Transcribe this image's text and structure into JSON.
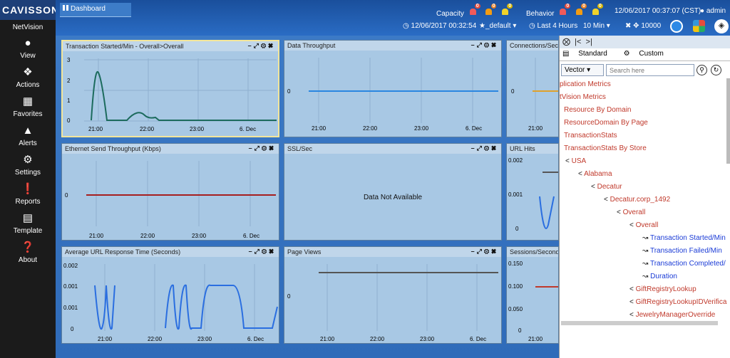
{
  "app": {
    "logo": "CAVISSON",
    "product": "NetVision",
    "dashboard_tab": "Dashboard"
  },
  "topbar": {
    "capacity_label": "Capacity",
    "capacity_badges": [
      "0",
      "0",
      "0"
    ],
    "behavior_label": "Behavior",
    "behavior_badges": [
      "0",
      "0",
      "0"
    ],
    "datetime": "12/06/2017 00:37:07 (CST)",
    "user": "admin",
    "clock_time": "12/06/2017 00:32:54",
    "favorite": "_default",
    "duration": "Last 4 Hours",
    "interval": "10 Min",
    "count": "10000"
  },
  "sidebar": {
    "items": [
      {
        "label": "View",
        "icon": "user-icon"
      },
      {
        "label": "Actions",
        "icon": "puzzle-icon"
      },
      {
        "label": "Favorites",
        "icon": "grid-icon"
      },
      {
        "label": "Alerts",
        "icon": "bell-icon"
      },
      {
        "label": "Settings",
        "icon": "gear-icon"
      },
      {
        "label": "Reports",
        "icon": "exclamation-icon"
      },
      {
        "label": "Template",
        "icon": "template-icon"
      },
      {
        "label": "About",
        "icon": "question-icon"
      }
    ]
  },
  "panels": [
    {
      "title": "Transaction Started/Min - Overall>Overall",
      "yticks": [
        "3",
        "2",
        "1",
        "0"
      ],
      "xticks": [
        "21:00",
        "22:00",
        "23:00",
        "6. Dec"
      ]
    },
    {
      "title": "Data Throughput",
      "yticks": [
        "0"
      ],
      "xticks": [
        "21:00",
        "22:00",
        "23:00",
        "6. Dec"
      ]
    },
    {
      "title": "Connections/Sec",
      "yticks": [
        "0"
      ],
      "xticks": [
        "21:00"
      ]
    },
    {
      "title": "Ethernet Send Throughput (Kbps)",
      "yticks": [
        "0"
      ],
      "xticks": [
        "21:00",
        "22:00",
        "23:00",
        "6. Dec"
      ]
    },
    {
      "title": "SSL/Sec",
      "message": "Data Not Available"
    },
    {
      "title": "URL Hits",
      "yticks": [
        "0.002",
        "0.001",
        "0"
      ],
      "xticks": [
        "21:00"
      ]
    },
    {
      "title": "Average URL Response Time (Seconds)",
      "yticks": [
        "0.002",
        "0.001",
        "0.001",
        "0"
      ],
      "xticks": [
        "21:00",
        "22:00",
        "23:00",
        "6. Dec"
      ]
    },
    {
      "title": "Page Views",
      "yticks": [
        "0"
      ],
      "xticks": [
        "21:00",
        "22:00",
        "23:00",
        "6. Dec"
      ]
    },
    {
      "title": "Sessions/Second",
      "yticks": [
        "0.150",
        "0.100",
        "0.050",
        "0"
      ],
      "xticks": [
        "21:00"
      ]
    }
  ],
  "tree": {
    "tabs": [
      "Standard",
      "Custom"
    ],
    "dropdown": "Vector",
    "search_placeholder": "Search here",
    "items": [
      "plication Metrics",
      "tVision Metrics",
      "Resource By Domain",
      "ResourceDomain By Page",
      "TransactionStats",
      "TransactionStats By Store",
      "USA",
      "Alabama",
      "Decatur",
      "Decatur.corp_1492",
      "Overall",
      "Overall",
      "Transaction Started/Min",
      "Transaction Failed/Min",
      "Transaction Completed/",
      "Duration",
      "GiftRegistryLookup",
      "GiftRegistryLookupIDVerifica",
      "JewelryManagerOverride"
    ]
  },
  "colors": {
    "accent": "#2a6cc4",
    "sidebar": "#1b1b1b",
    "tree_red": "#c0392b",
    "tree_blue": "#1a3bd6"
  }
}
